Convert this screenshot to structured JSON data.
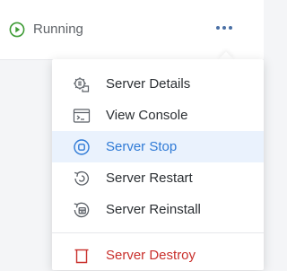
{
  "status": {
    "label": "Running",
    "icon": "play-circle-icon",
    "color": "#3e9b35"
  },
  "more_button": {
    "icon": "more-dots-icon",
    "color": "#4a6fa5"
  },
  "menu": {
    "items": [
      {
        "label": "Server Details",
        "icon": "gear-document-icon",
        "active": false,
        "danger": false
      },
      {
        "label": "View Console",
        "icon": "console-window-icon",
        "active": false,
        "danger": false
      },
      {
        "label": "Server Stop",
        "icon": "stop-circle-icon",
        "active": true,
        "danger": false
      },
      {
        "label": "Server Restart",
        "icon": "restart-icon",
        "active": false,
        "danger": false
      },
      {
        "label": "Server Reinstall",
        "icon": "reinstall-icon",
        "active": false,
        "danger": false
      }
    ],
    "danger_item": {
      "label": "Server Destroy",
      "icon": "trash-icon",
      "danger": true
    },
    "active_color": "#2f7ad6",
    "active_bg": "#eaf2fd",
    "danger_color": "#c9302c"
  }
}
